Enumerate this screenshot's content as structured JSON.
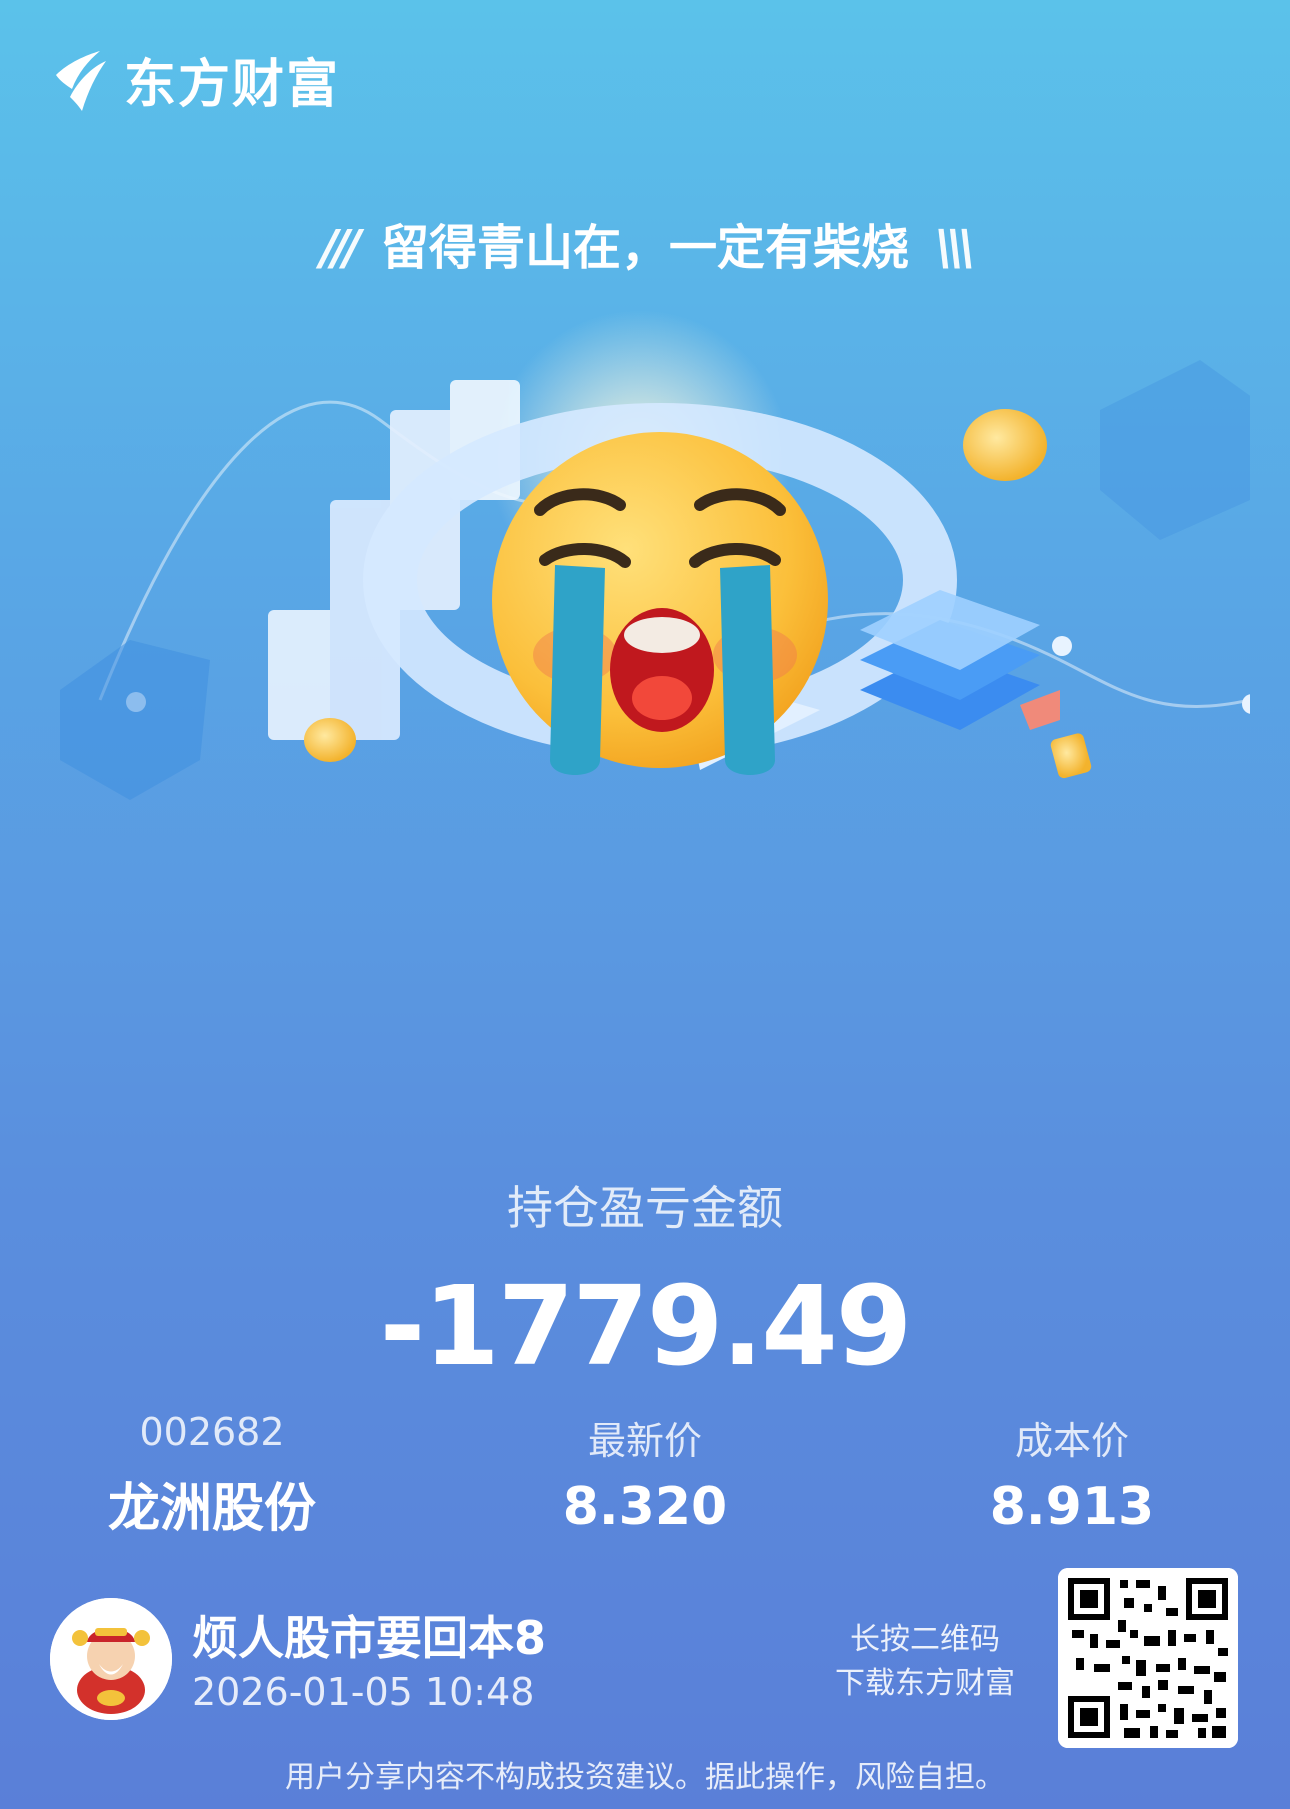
{
  "brand": {
    "name": "东方财富",
    "logo_icon": "eastmoney-logo-icon"
  },
  "slogan": {
    "left_deco": "///",
    "text": "留得青山在，一定有柴烧",
    "right_deco": "\\\\\\"
  },
  "hero": {
    "icon": "crying-emoji-icon"
  },
  "pnl": {
    "title": "持仓盈亏金额",
    "value": "-1779.49"
  },
  "stock": {
    "code": "002682",
    "name": "龙洲股份"
  },
  "latest_price": {
    "label": "最新价",
    "value": "8.320"
  },
  "cost_price": {
    "label": "成本价",
    "value": "8.913"
  },
  "user": {
    "name": "烦人股市要回本8",
    "time": "2026-01-05 10:48",
    "avatar_icon": "god-of-wealth-avatar-icon"
  },
  "qr": {
    "hint_line1": "长按二维码",
    "hint_line2": "下载东方财富",
    "icon": "qr-code-icon"
  },
  "disclaimer": "用户分享内容不构成投资建议。据此操作，风险自担。"
}
